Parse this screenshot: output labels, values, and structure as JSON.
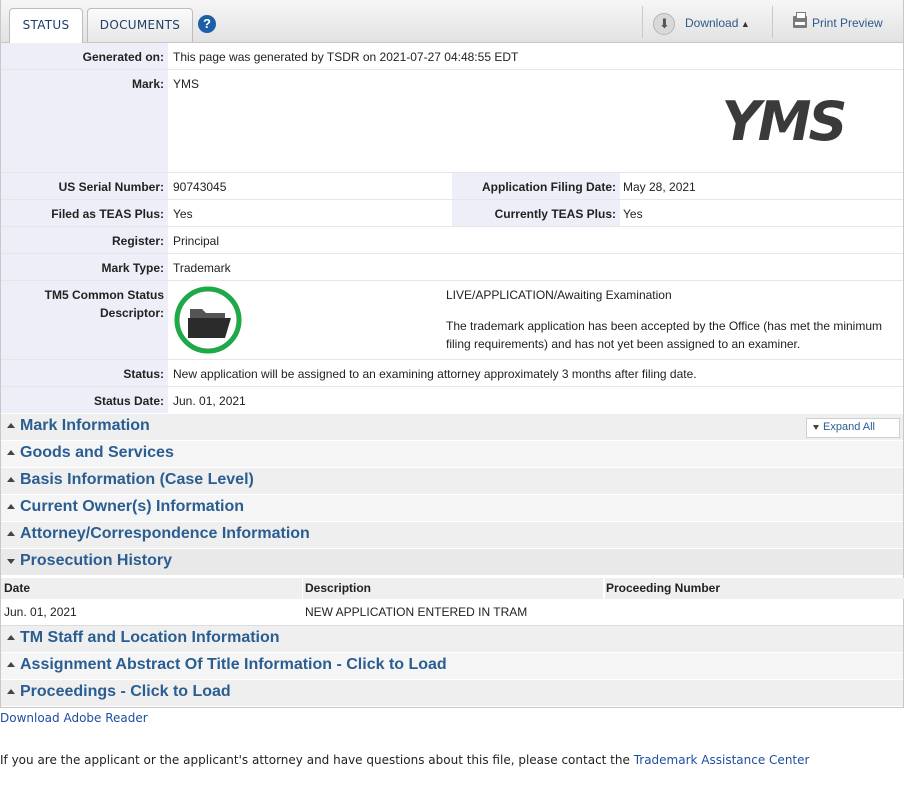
{
  "tabs": {
    "status": "STATUS",
    "documents": "DOCUMENTS",
    "help": "?"
  },
  "toolbar": {
    "download": "Download",
    "print_preview": "Print Preview"
  },
  "info": {
    "generated_on_label": "Generated on:",
    "generated_on_value": "This page was generated by TSDR on 2021-07-27 04:48:55 EDT",
    "mark_label": "Mark:",
    "mark_value": "YMS",
    "serial_label": "US Serial Number:",
    "serial_value": "90743045",
    "filing_date_label": "Application Filing Date:",
    "filing_date_value": "May 28, 2021",
    "teas_plus_label": "Filed as TEAS Plus:",
    "teas_plus_value": "Yes",
    "current_teas_label": "Currently TEAS Plus:",
    "current_teas_value": "Yes",
    "register_label": "Register:",
    "register_value": "Principal",
    "mark_type_label": "Mark Type:",
    "mark_type_value": "Trademark",
    "tm5_label_line1": "TM5 Common Status",
    "tm5_label_line2": "Descriptor:",
    "tm5_status": "LIVE/APPLICATION/Awaiting Examination",
    "tm5_desc": "The trademark application has been accepted by the Office (has met the minimum filing requirements) and has not yet been assigned to an examiner.",
    "status_label": "Status:",
    "status_value": "New application will be assigned to an examining attorney approximately 3 months after filing date.",
    "status_date_label": "Status Date:",
    "status_date_value": "Jun. 01, 2021"
  },
  "mark_image_text": "YMS",
  "expand_all": "Expand All",
  "sections": [
    "Mark Information",
    "Goods and Services",
    "Basis Information (Case Level)",
    "Current Owner(s) Information",
    "Attorney/Correspondence Information",
    "Prosecution History",
    "TM Staff and Location Information",
    "Assignment Abstract Of Title Information - Click to Load",
    "Proceedings - Click to Load"
  ],
  "prosecution": {
    "headers": [
      "Date",
      "Description",
      "Proceeding Number"
    ],
    "rows": [
      [
        "Jun. 01, 2021",
        "NEW APPLICATION ENTERED IN TRAM",
        ""
      ]
    ]
  },
  "footer": {
    "adobe_link": "Download Adobe Reader",
    "contact_text": "If you are the applicant or the applicant's attorney and have questions about this file, please contact the ",
    "contact_link": "Trademark Assistance Center"
  },
  "colors": {
    "section_title": "#2a5d91",
    "label_bg": "#eeeef8",
    "status_green": "#1ea84a"
  }
}
